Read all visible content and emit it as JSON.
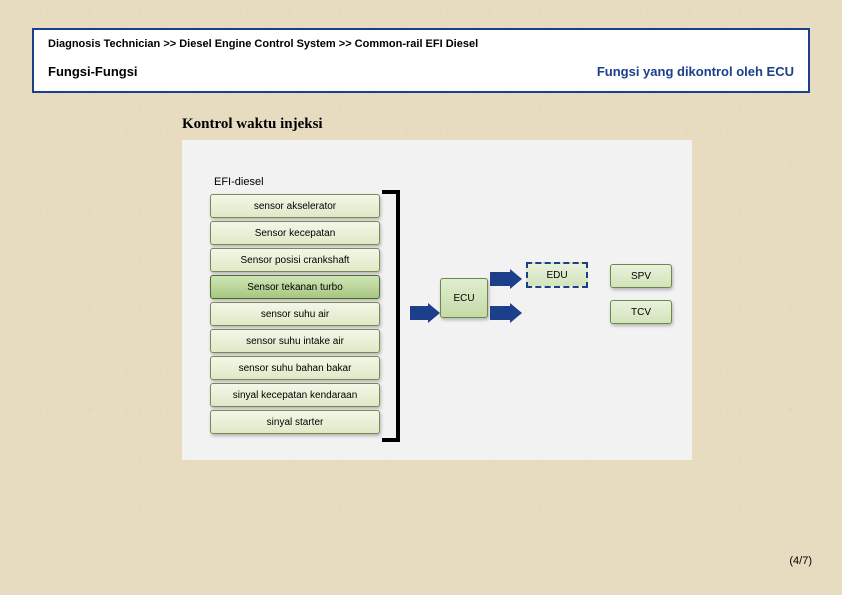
{
  "header": {
    "breadcrumb": "Diagnosis Technician >> Diesel Engine Control System >> Common-rail EFI Diesel",
    "left": "Fungsi-Fungsi",
    "right": "Fungsi yang dikontrol oleh ECU"
  },
  "section_title": "Kontrol waktu injeksi",
  "diagram": {
    "efi_label": "EFI-diesel",
    "sensors": [
      {
        "label": "sensor akselerator",
        "hl": false
      },
      {
        "label": "Sensor kecepatan",
        "hl": false
      },
      {
        "label": "Sensor posisi crankshaft",
        "hl": false
      },
      {
        "label": "Sensor tekanan turbo",
        "hl": true
      },
      {
        "label": "sensor suhu air",
        "hl": false
      },
      {
        "label": "sensor suhu intake air",
        "hl": false
      },
      {
        "label": "sensor suhu bahan bakar",
        "hl": false
      },
      {
        "label": "sinyal kecepatan kendaraan",
        "hl": false
      },
      {
        "label": "sinyal starter",
        "hl": false
      }
    ],
    "ecu": "ECU",
    "edu": "EDU",
    "spv": "SPV",
    "tcv": "TCV"
  },
  "page": "(4/7)",
  "chart_data": {
    "type": "diagram",
    "title": "Kontrol waktu injeksi",
    "nodes": [
      {
        "id": "sensors",
        "label": "EFI-diesel sensor group",
        "items": [
          "sensor akselerator",
          "Sensor kecepatan",
          "Sensor posisi crankshaft",
          "Sensor tekanan turbo",
          "sensor suhu air",
          "sensor suhu intake air",
          "sensor suhu bahan bakar",
          "sinyal kecepatan kendaraan",
          "sinyal starter"
        ]
      },
      {
        "id": "ecu",
        "label": "ECU"
      },
      {
        "id": "edu",
        "label": "EDU"
      },
      {
        "id": "spv",
        "label": "SPV"
      },
      {
        "id": "tcv",
        "label": "TCV"
      }
    ],
    "edges": [
      {
        "from": "sensors",
        "to": "ecu"
      },
      {
        "from": "ecu",
        "to": "edu"
      },
      {
        "from": "ecu",
        "to": "tcv"
      },
      {
        "from": "edu",
        "to": "spv"
      }
    ]
  }
}
